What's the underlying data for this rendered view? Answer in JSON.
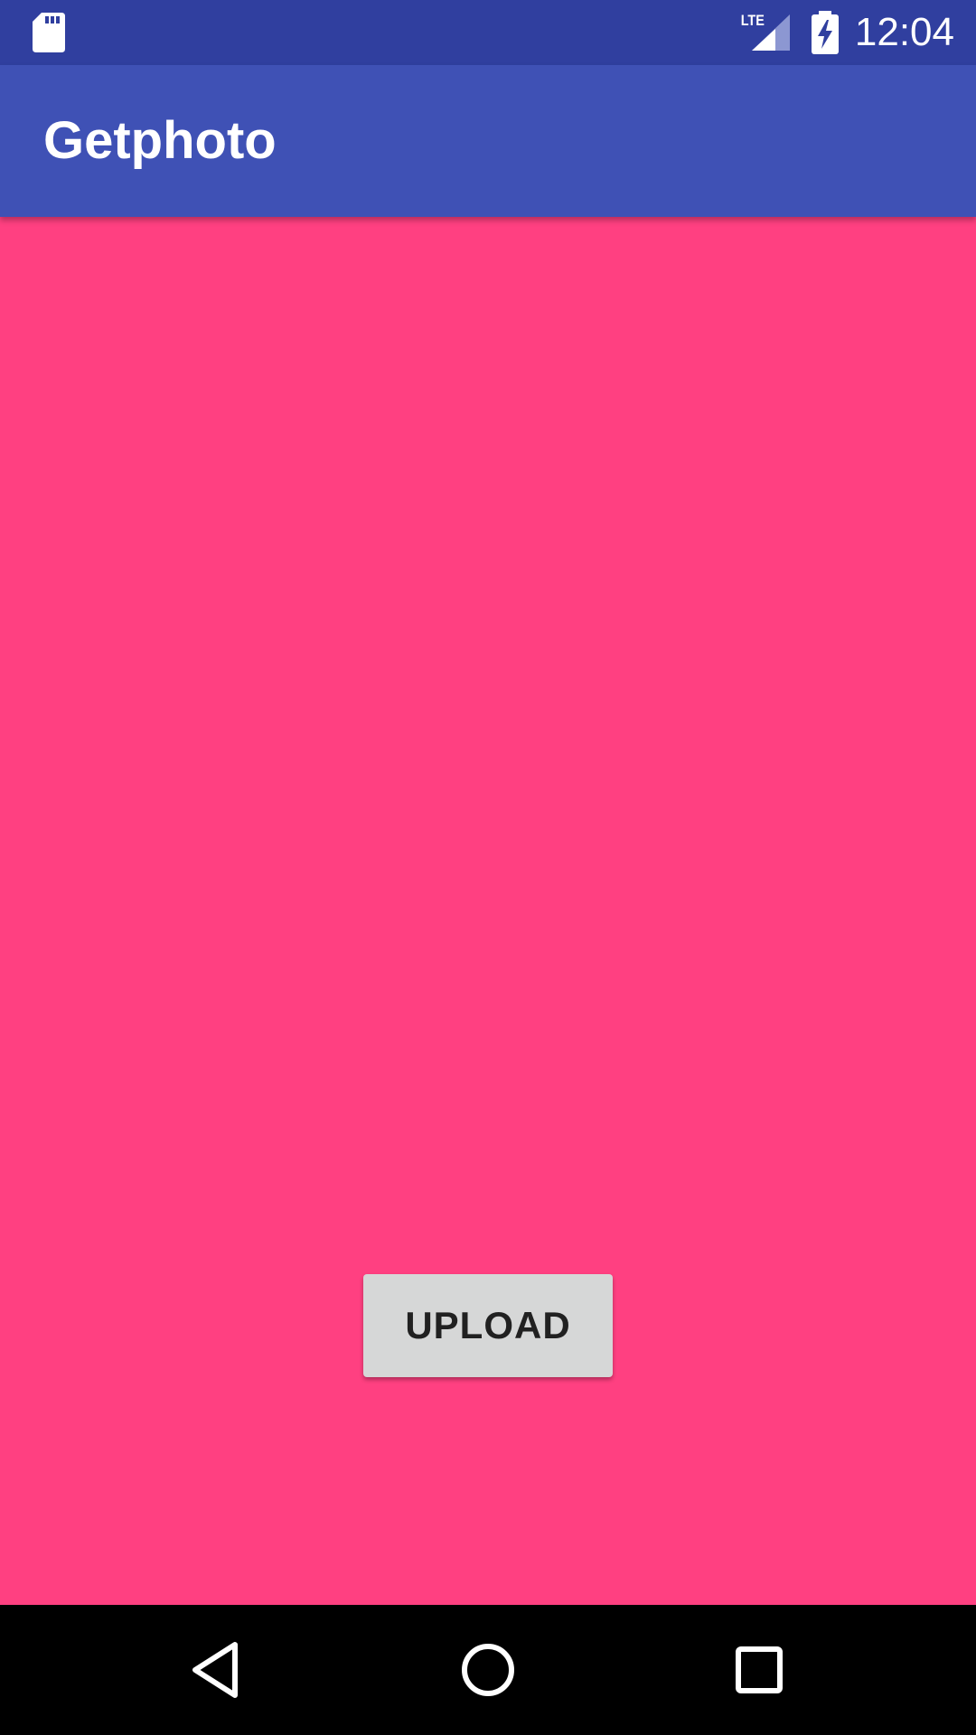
{
  "status_bar": {
    "time": "12:04",
    "network_label": "LTE",
    "icons": [
      "sd-card-icon",
      "lte-signal-icon",
      "battery-charging-icon"
    ]
  },
  "app_bar": {
    "title": "Getphoto"
  },
  "main": {
    "upload_button_label": "UPLOAD"
  },
  "nav_bar": {
    "icons": [
      "back-icon",
      "home-icon",
      "recents-icon"
    ]
  },
  "colors": {
    "status_bar": "#303f9f",
    "app_bar": "#3f51b5",
    "background": "#ff4081",
    "button": "#d6d7d7",
    "nav_bar": "#000000"
  }
}
